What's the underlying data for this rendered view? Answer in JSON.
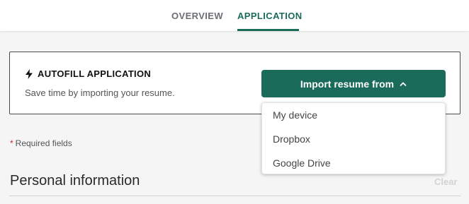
{
  "tabs": [
    {
      "label": "OVERVIEW",
      "active": false
    },
    {
      "label": "APPLICATION",
      "active": true
    }
  ],
  "autofill": {
    "icon": "bolt-icon",
    "title": "AUTOFILL APPLICATION",
    "subtitle": "Save time by importing your resume."
  },
  "import_button": {
    "label": "Import resume from",
    "icon": "chevron-up-icon"
  },
  "dropdown": {
    "items": [
      "My device",
      "Dropbox",
      "Google Drive"
    ]
  },
  "form": {
    "required_star": "*",
    "required_text": "Required fields",
    "section_title": "Personal information",
    "clear_label": "Clear"
  },
  "colors": {
    "accent": "#1b6b5a",
    "required": "#c62828"
  }
}
